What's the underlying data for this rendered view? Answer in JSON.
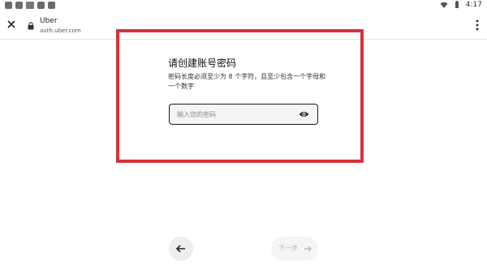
{
  "status_bar": {
    "time": "4:17"
  },
  "browser": {
    "title": "Uber",
    "url": "auth.uber.com"
  },
  "content": {
    "heading": "请创建账号密码",
    "description": "密码长度必须至少为 8 个字符，且至少包含一个字母和一个数字",
    "password_placeholder": "输入您的密码"
  },
  "nav": {
    "next_label": "下一步"
  },
  "colors": {
    "highlight": "#d6333a",
    "field_border": "#1a1a1a",
    "disabled_text": "#b5b5b5"
  }
}
